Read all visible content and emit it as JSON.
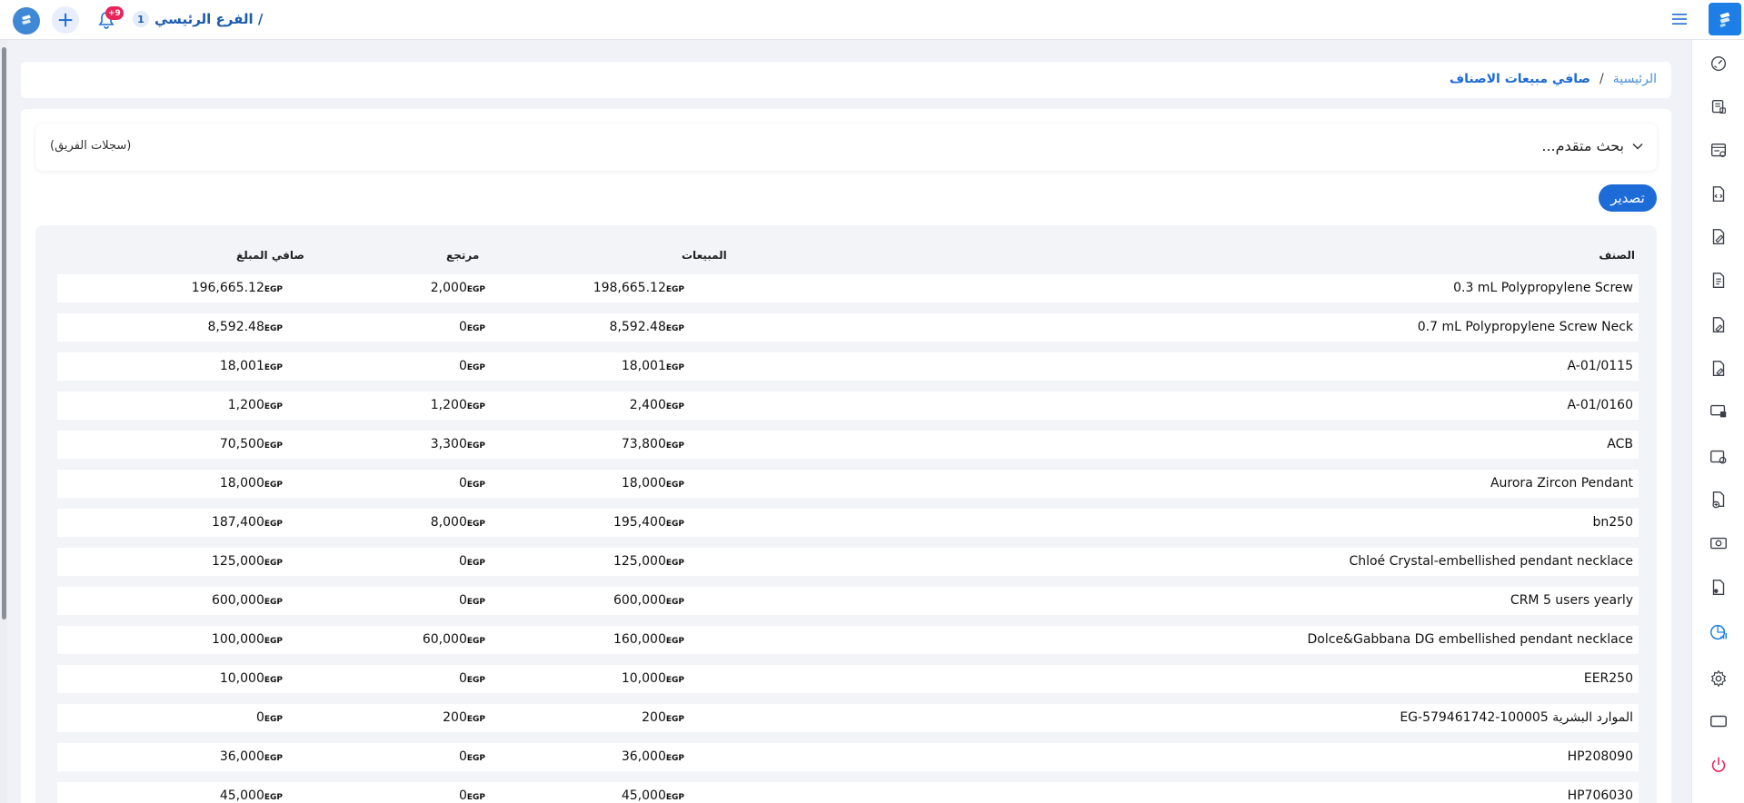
{
  "topbar": {
    "branch_name": "الفرع الرئيسي /",
    "branch_number": "1",
    "notification_count": "+9"
  },
  "breadcrumb": {
    "home": "الرئيسية",
    "separator": "/",
    "current": "صافي مبيعات الاصناف"
  },
  "advanced_search": {
    "title": "بحث متقدم...",
    "team_records": "(سجلات الفريق)"
  },
  "export_label": "تصدير",
  "currency": "EGP",
  "table": {
    "headers": {
      "item": "الصنف",
      "sales": "المبيعات",
      "returns": "مرتجع",
      "net": "صافي المبلغ"
    },
    "rows": [
      {
        "item": "0.3 mL Polypropylene Screw",
        "sales": "198,665.12",
        "returns": "2,000",
        "net": "196,665.12"
      },
      {
        "item": "0.7 mL Polypropylene Screw Neck",
        "sales": "8,592.48",
        "returns": "0",
        "net": "8,592.48"
      },
      {
        "item": "A-01/0115",
        "sales": "18,001",
        "returns": "0",
        "net": "18,001"
      },
      {
        "item": "A-01/0160",
        "sales": "2,400",
        "returns": "1,200",
        "net": "1,200"
      },
      {
        "item": "ACB",
        "sales": "73,800",
        "returns": "3,300",
        "net": "70,500"
      },
      {
        "item": "Aurora Zircon Pendant",
        "sales": "18,000",
        "returns": "0",
        "net": "18,000"
      },
      {
        "item": "bn250",
        "sales": "195,400",
        "returns": "8,000",
        "net": "187,400"
      },
      {
        "item": "Chloé Crystal-embellished pendant necklace",
        "sales": "125,000",
        "returns": "0",
        "net": "125,000"
      },
      {
        "item": "CRM 5 users yearly",
        "sales": "600,000",
        "returns": "0",
        "net": "600,000"
      },
      {
        "item": "Dolce&Gabbana DG embellished pendant necklace",
        "sales": "160,000",
        "returns": "60,000",
        "net": "100,000"
      },
      {
        "item": "EER250",
        "sales": "10,000",
        "returns": "0",
        "net": "10,000"
      },
      {
        "item": "EG-579461742-100005 الموارد البشرية",
        "sales": "200",
        "returns": "200",
        "net": "0"
      },
      {
        "item": "HP208090",
        "sales": "36,000",
        "returns": "0",
        "net": "36,000"
      },
      {
        "item": "HP706030",
        "sales": "45,000",
        "returns": "0",
        "net": "45,000"
      }
    ]
  },
  "sidebar_icons": [
    "dashboard-gauge-icon",
    "pos-register-icon",
    "invoice-list-icon",
    "code-file-icon",
    "edit-document-icon",
    "text-document-icon",
    "edit-file-icon",
    "edit-sheet-icon",
    "screen-user-icon",
    "image-settings-icon",
    "add-document-icon",
    "cash-icon",
    "user-document-icon",
    "sales-chart-icon",
    "settings-gear-icon",
    "window-icon",
    "power-icon"
  ],
  "colors": {
    "accent": "#1c6bd6",
    "sidebar_active": "#1c7ee6",
    "badge": "#e8245b",
    "power": "#e8245b"
  }
}
